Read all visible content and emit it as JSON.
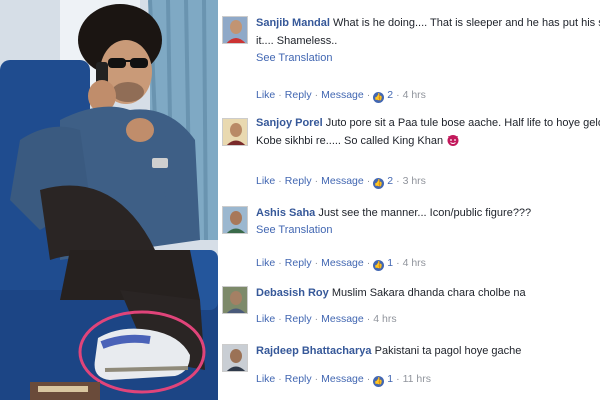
{
  "comments": [
    {
      "author": "Sanjib Mandal",
      "lines": [
        "What is he doing.... That is sleeper and he has put his shoe on",
        "it.... Shameless.."
      ],
      "see_translation": "See Translation",
      "actions": {
        "like": "Like",
        "reply": "Reply",
        "message": "Message",
        "reactions": "2",
        "time": "4 hrs"
      }
    },
    {
      "author": "Sanjoy Porel",
      "lines": [
        "Juto pore sit a Paa tule bose aache. Half life to hoye gelo manne",
        "Kobe sikhbi re..... So called King Khan"
      ],
      "actions": {
        "like": "Like",
        "reply": "Reply",
        "message": "Message",
        "reactions": "2",
        "time": "3 hrs"
      }
    },
    {
      "author": "Ashis Saha",
      "lines": [
        "Just see the manner... Icon/public figure???"
      ],
      "see_translation": "See Translation",
      "actions": {
        "like": "Like",
        "reply": "Reply",
        "message": "Message",
        "reactions": "1",
        "time": "4 hrs"
      }
    },
    {
      "author": "Debasish Roy",
      "lines": [
        "Muslim Sakara dhanda chara cholbe na"
      ],
      "actions": {
        "like": "Like",
        "reply": "Reply",
        "message": "Message",
        "time": "4 hrs"
      }
    },
    {
      "author": "Rajdeep Bhattacharya",
      "lines": [
        "Pakistani ta pagol hoye gache"
      ],
      "actions": {
        "like": "Like",
        "reply": "Reply",
        "message": "Message",
        "reactions": "1",
        "time": "11 hrs"
      }
    }
  ],
  "colors": {
    "link": "#4267b2",
    "author": "#365899",
    "meta": "#90949c",
    "highlight_circle": "#e0447a"
  },
  "icons": {
    "reaction": "like-badge-icon",
    "emoji": "devil-emoji-icon"
  }
}
